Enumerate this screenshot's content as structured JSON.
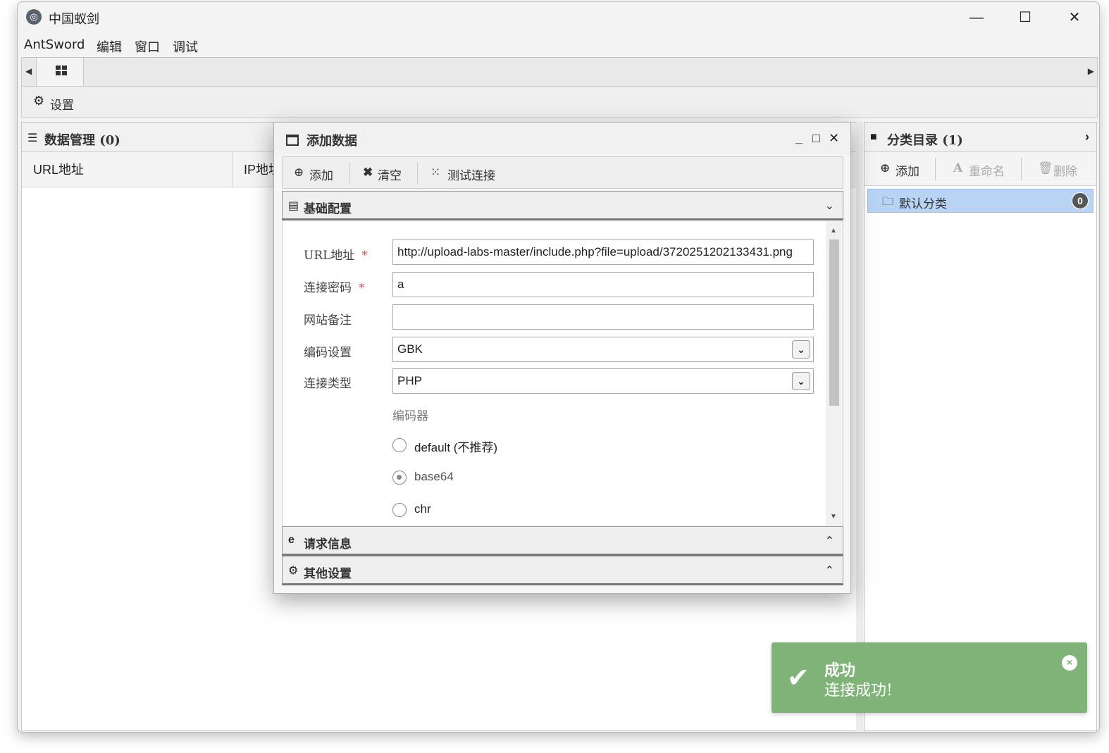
{
  "window": {
    "title": "中国蚁剑",
    "minimize": "—",
    "maximize": "☐",
    "close": "✕"
  },
  "menu": [
    "AntSword",
    "编辑",
    "窗口",
    "调试"
  ],
  "toolbar": {
    "settings_label": "设置"
  },
  "data_panel": {
    "title": "数据管理 (0)",
    "columns": [
      "URL地址",
      "IP地址"
    ]
  },
  "category_panel": {
    "title": "分类目录 (1)",
    "add_label": "添加",
    "rename_label": "重命名",
    "delete_label": "删除",
    "items": [
      {
        "name": "默认分类",
        "count": "0"
      }
    ]
  },
  "dialog": {
    "title": "添加数据",
    "add_label": "添加",
    "clear_label": "清空",
    "test_label": "测试连接",
    "sections": {
      "basic": "基础配置",
      "request": "请求信息",
      "other": "其他设置"
    },
    "form": {
      "url_label": "URL地址",
      "url_value": "http://upload-labs-master/include.php?file=upload/3720251202133431.png",
      "password_label": "连接密码",
      "password_value": "a",
      "note_label": "网站备注",
      "note_value": "",
      "encoding_label": "编码设置",
      "encoding_value": "GBK",
      "type_label": "连接类型",
      "type_value": "PHP",
      "required_mark": "*",
      "encoder_title": "编码器",
      "encoders": [
        {
          "label": "default (不推荐)",
          "checked": false
        },
        {
          "label": "base64",
          "checked": true
        },
        {
          "label": "chr",
          "checked": false
        }
      ]
    }
  },
  "toast": {
    "title": "成功",
    "message": "连接成功!"
  }
}
